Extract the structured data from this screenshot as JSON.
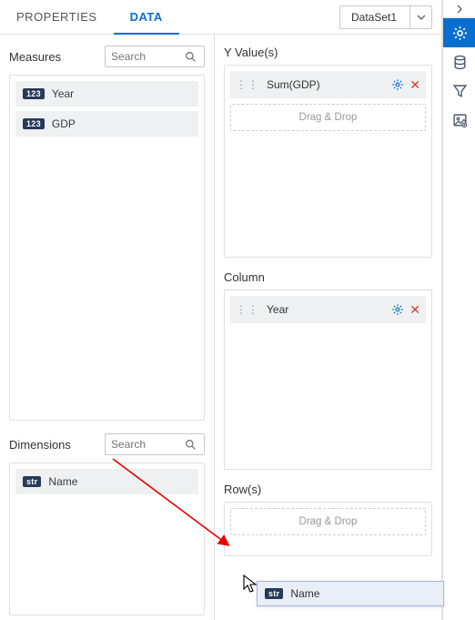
{
  "tabs": {
    "properties": "PROPERTIES",
    "data": "DATA",
    "active": "data"
  },
  "dataset": {
    "selected": "DataSet1"
  },
  "measures": {
    "title": "Measures",
    "search_placeholder": "Search",
    "items": [
      {
        "type": "123",
        "label": "Year"
      },
      {
        "type": "123",
        "label": "GDP"
      }
    ]
  },
  "dimensions": {
    "title": "Dimensions",
    "search_placeholder": "Search",
    "items": [
      {
        "type": "str",
        "label": "Name"
      }
    ]
  },
  "yvalues": {
    "title": "Y Value(s)",
    "items": [
      {
        "label": "Sum(GDP)"
      }
    ],
    "drop_hint": "Drag & Drop"
  },
  "column": {
    "title": "Column",
    "items": [
      {
        "label": "Year"
      }
    ]
  },
  "rows": {
    "title": "Row(s)",
    "drop_hint": "Drag & Drop"
  },
  "drag_ghost": {
    "type": "str",
    "label": "Name"
  }
}
